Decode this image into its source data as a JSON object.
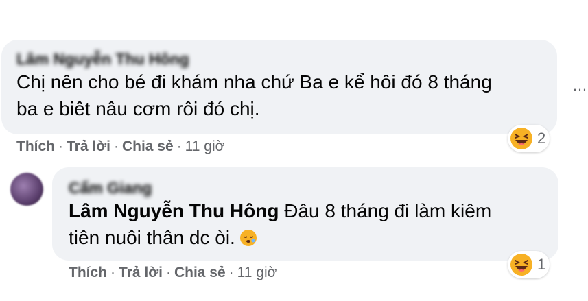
{
  "comments": [
    {
      "author": "Lâm Nguyễn Thu Hông",
      "text_line1": "Chị nên cho bé đi khám nha chứ Ba e kể hôi đó 8 tháng",
      "text_line2": "ba e biêt nâu cơm rôi đó chị.",
      "actions": {
        "like": "Thích",
        "reply": "Trả lời",
        "share": "Chia sẻ",
        "time": "11 giờ"
      },
      "reaction": {
        "icon": "haha-emoji-icon",
        "count": "2"
      }
    },
    {
      "author": "Cẩm Giang",
      "mention": "Lâm Nguyễn Thu Hông",
      "text_part1": "Đâu 8 tháng đi làm kiêm",
      "text_line2": "tiên nuôi thân dc òi.",
      "actions": {
        "like": "Thích",
        "reply": "Trả lời",
        "share": "Chia sẻ",
        "time": "11 giờ"
      },
      "reaction": {
        "icon": "haha-emoji-icon",
        "count": "1"
      }
    }
  ],
  "more_options": "…",
  "colors": {
    "bubble": "#f0f2f5",
    "meta_text": "#65676b",
    "emoji_face": "#f7b125",
    "emoji_mouth": "#5d2a14"
  }
}
